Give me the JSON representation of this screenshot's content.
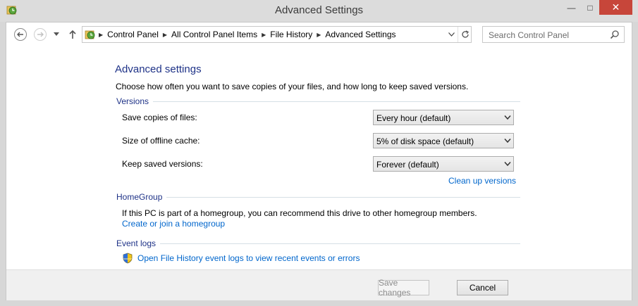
{
  "window": {
    "title": "Advanced Settings"
  },
  "caption_buttons": {
    "minimize": "—",
    "maximize": "□",
    "close": "✕"
  },
  "address": {
    "crumbs": [
      "Control Panel",
      "All Control Panel Items",
      "File History",
      "Advanced Settings"
    ]
  },
  "search": {
    "placeholder": "Search Control Panel"
  },
  "page": {
    "heading": "Advanced settings",
    "description": "Choose how often you want to save copies of your files, and how long to keep saved versions."
  },
  "versions": {
    "label": "Versions",
    "rows": [
      {
        "label": "Save copies of files:",
        "value": "Every hour (default)"
      },
      {
        "label": "Size of offline cache:",
        "value": "5% of disk space (default)"
      },
      {
        "label": "Keep saved versions:",
        "value": "Forever (default)"
      }
    ],
    "clean_link": "Clean up versions"
  },
  "homegroup": {
    "label": "HomeGroup",
    "text": "If this PC is part of a homegroup, you can recommend this drive to other homegroup members.",
    "link": "Create or join a homegroup"
  },
  "event_logs": {
    "label": "Event logs",
    "link": "Open File History event logs to view recent events or errors"
  },
  "buttons": {
    "save": "Save changes",
    "cancel": "Cancel"
  },
  "colors": {
    "heading": "#1e3287",
    "link": "#0066cc",
    "close": "#c7463a"
  }
}
